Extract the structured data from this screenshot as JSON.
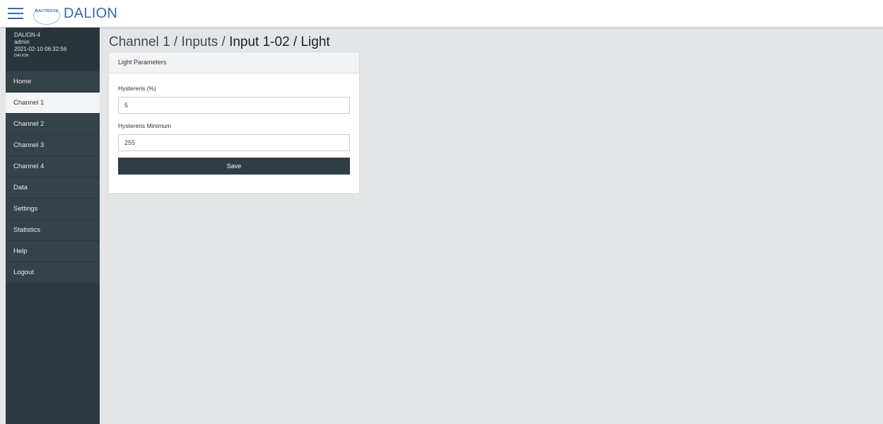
{
  "header": {
    "brand_mark": "BACTROVE",
    "title": "DALION"
  },
  "sidebar": {
    "device": "DALION-4",
    "user": "admin",
    "datetime": "2021-02-10 06:32:56",
    "product": "DALION",
    "items": [
      {
        "label": "Home"
      },
      {
        "label": "Channel 1",
        "active": true
      },
      {
        "label": "Channel 2"
      },
      {
        "label": "Channel 3"
      },
      {
        "label": "Channel 4"
      },
      {
        "label": "Data"
      },
      {
        "label": "Settings"
      },
      {
        "label": "Statistics"
      },
      {
        "label": "Help"
      },
      {
        "label": "Logout"
      }
    ]
  },
  "breadcrumb": {
    "part1": "Channel 1",
    "sep1": " / ",
    "part2": "Inputs",
    "sep2": " / ",
    "current": "Input 1-02 / Light"
  },
  "card": {
    "title": "Light Parameters",
    "field1_label": "Hystereris (%)",
    "field1_value": "5",
    "field2_label": "Hystereris Minimum",
    "field2_value": "255",
    "save_label": "Save"
  },
  "icons": {
    "menu": "hamburger-menu-icon",
    "logo": "bactrove-logo"
  },
  "colors": {
    "sidebar": "#2d3a40",
    "accent": "#3a6aa8",
    "button": "#2f3d45",
    "background": "#e4e5e7"
  }
}
